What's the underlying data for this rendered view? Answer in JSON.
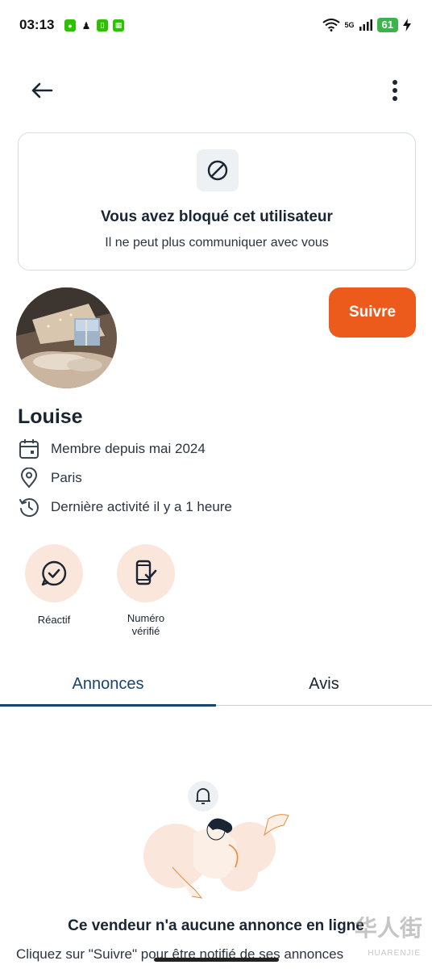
{
  "status_bar": {
    "time": "03:13",
    "network": "5G",
    "battery": "61"
  },
  "blocked": {
    "title": "Vous avez bloqué cet utilisateur",
    "subtitle": "Il ne peut plus communiquer avec vous"
  },
  "profile": {
    "name": "Louise",
    "follow_label": "Suivre",
    "member_since": "Membre depuis mai 2024",
    "location": "Paris",
    "last_activity": "Dernière activité il y a 1 heure"
  },
  "badges": [
    {
      "label": "Réactif"
    },
    {
      "label": "Numéro vérifié"
    }
  ],
  "tabs": [
    {
      "label": "Annonces",
      "active": true
    },
    {
      "label": "Avis",
      "active": false
    }
  ],
  "empty_state": {
    "title": "Ce vendeur n'a aucune annonce en ligne",
    "subtitle": "Cliquez sur \"Suivre\" pour être notifié de ses annonces"
  },
  "watermark": {
    "main": "华人街",
    "sub": "HUARENJIE"
  },
  "colors": {
    "accent": "#ec5a1c",
    "tab_active": "#17456b",
    "badge_bg": "#fbe6dc"
  }
}
